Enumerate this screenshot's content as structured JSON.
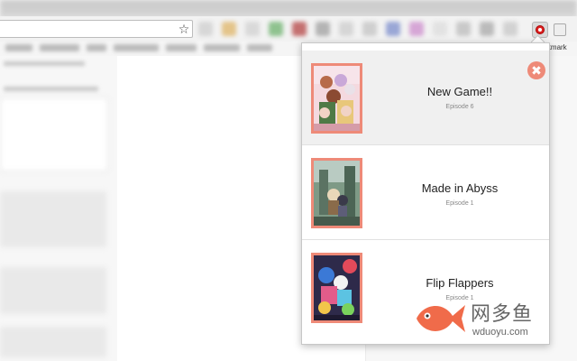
{
  "browser": {
    "star_icon": "star-icon",
    "bookmarks_partial": "ookmark",
    "ext_colors": [
      "#d7d7d7",
      "#e4c48a",
      "#d9d9d9",
      "#8fc28f",
      "#c47070",
      "#b4b4b4",
      "#d6d6d6",
      "#cfcfcf",
      "#9aa7d6",
      "#d6a6d6",
      "#e2e2e2",
      "#c9c9c9",
      "#bbbbbb",
      "#d2d2d2"
    ]
  },
  "popup": {
    "close_icon": "✖",
    "items": [
      {
        "title": "New Game!!",
        "episode": "Episode 6"
      },
      {
        "title": "Made in Abyss",
        "episode": "Episode 1"
      },
      {
        "title": "Flip Flappers",
        "episode": "Episode 1"
      }
    ]
  },
  "watermark": {
    "name": "网多鱼",
    "url": "wduoyu.com"
  },
  "colors": {
    "accent": "#ee8a78",
    "fish": "#f06b4a"
  }
}
